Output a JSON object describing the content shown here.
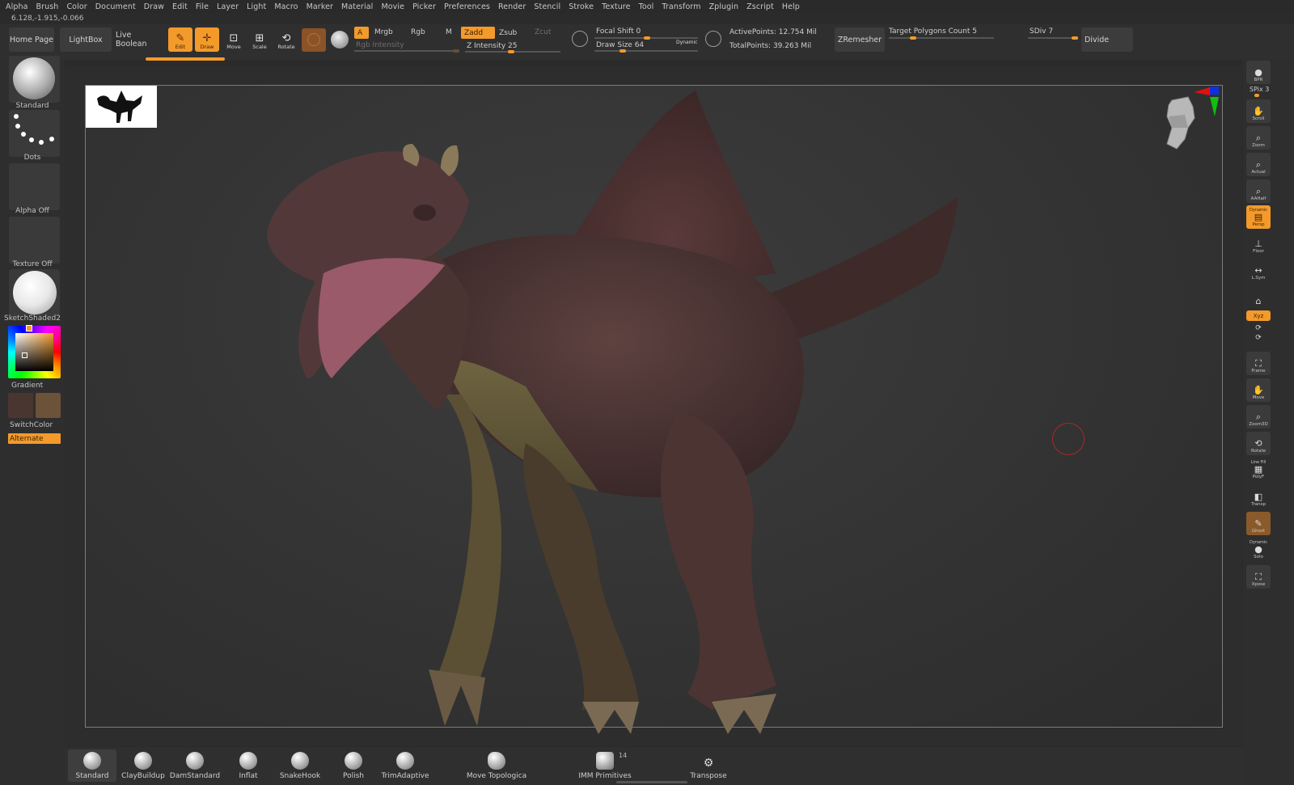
{
  "menu": [
    "Alpha",
    "Brush",
    "Color",
    "Document",
    "Draw",
    "Edit",
    "File",
    "Layer",
    "Light",
    "Macro",
    "Marker",
    "Material",
    "Movie",
    "Picker",
    "Preferences",
    "Render",
    "Stencil",
    "Stroke",
    "Texture",
    "Tool",
    "Transform",
    "Zplugin",
    "Zscript",
    "Help"
  ],
  "coords": "6.128,-1.915,-0.066",
  "top_shelf": {
    "home_page": "Home Page",
    "lightbox": "LightBox",
    "live_boolean": "Live Boolean",
    "edit": "Edit",
    "draw": "Draw",
    "move": "Move",
    "scale": "Scale",
    "rotate": "Rotate",
    "a": "A",
    "mrgb": "Mrgb",
    "rgb": "Rgb",
    "m": "M",
    "zadd": "Zadd",
    "zsub": "Zsub",
    "zcut": "Zcut",
    "rgb_intensity": "Rgb Intensity",
    "z_intensity": "Z Intensity 25",
    "focal_shift": "Focal Shift 0",
    "draw_size": "Draw Size 64",
    "dynamic": "Dynamic",
    "active_points": "ActivePoints: 12.754 Mil",
    "total_points": "TotalPoints: 39.263 Mil",
    "zremesher": "ZRemesher",
    "target_polygons": "Target Polygons Count 5",
    "sdiv": "SDiv 7",
    "divide": "Divide"
  },
  "left_panel": {
    "brush": "Standard",
    "stroke": "Dots",
    "alpha": "Alpha Off",
    "texture": "Texture Off",
    "material": "SketchShaded2",
    "gradient": "Gradient",
    "switch_color": "SwitchColor",
    "alternate": "Alternate",
    "colors": {
      "main": "#4a3630",
      "secondary": "#6b5238",
      "accent": "#f39a2b"
    }
  },
  "right_panel": {
    "bpr": "BPR",
    "spix": "SPix 3",
    "scroll": "Scroll",
    "zoom": "Zoom",
    "actual": "Actual",
    "aahalf": "AAHalf",
    "dynamic": "Dynamic",
    "persp": "Persp",
    "floor": "Floor",
    "lsym": "L.Sym",
    "xyz": "Xyz",
    "frame": "Frame",
    "move": "Move",
    "zoom3d": "Zoom3D",
    "rotate": "Rotate",
    "line_fill": "Line Fill",
    "polyf": "PolyF",
    "transp": "Transp",
    "ghost": "Ghost",
    "dynamic2": "Dynamic",
    "solo": "Solo",
    "xpose": "Xpose"
  },
  "bottom_shelf": {
    "brushes": [
      "Standard",
      "ClayBuildup",
      "DamStandard",
      "Inflat",
      "SnakeHook",
      "Polish",
      "TrimAdaptive"
    ],
    "move_topological": "Move Topologica",
    "imm_primitives": "IMM Primitives",
    "imm_count": "14",
    "transpose": "Transpose"
  }
}
